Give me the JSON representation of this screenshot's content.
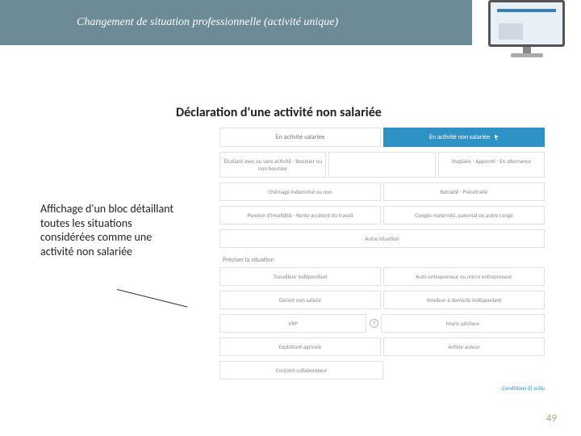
{
  "header": {
    "title": "Changement de situation professionnelle (activité unique)"
  },
  "slide": {
    "title": "Déclaration d'une activité non salariée",
    "left_text": "Affichage d'un bloc détaillant toutes les situations considérées comme une activité non salariée",
    "page_number": "49"
  },
  "mockup": {
    "tabs": {
      "salaried": "En activité salariée",
      "nonsalaried": "En activité non salariée"
    },
    "row1": {
      "c1": "Étudiant avec ou sans activité - Boursier ou non boursier",
      "c2": "",
      "c3": "Stagiaire - Apprenti - En alternance"
    },
    "row2": {
      "c1": "Chômage indemnisé ou non",
      "c2": "Retraité - Préretraité"
    },
    "row3": {
      "c1": "Pension d'invalidité - Rente accident du travail",
      "c2": "Congés maternité, parental ou autre congé"
    },
    "row4": "Autre situation",
    "sub_header": "Préciser la situation",
    "situations": {
      "r1c1": "Travailleur indépendant",
      "r1c2": "Auto entrepreneur ou micro entrepreneur",
      "r2c1": "Gérant non salarié",
      "r2c2": "Vendeur à domicile indépendant",
      "r3c1": "VRP",
      "r3c2": "Marin pêcheur",
      "r4c1": "Exploitant agricole",
      "r4c2": "Artiste auteur",
      "r5c1": "Conjoint collaborateur",
      "r5c2": ""
    },
    "help_icon": "?",
    "bottom_link": "Conditions (i)  suite"
  }
}
